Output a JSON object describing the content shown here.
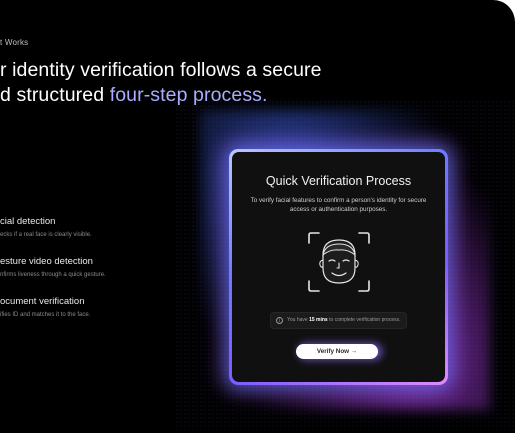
{
  "eyebrow": "t Works",
  "headline": {
    "line1": "r identity verification follows a secure",
    "line2_plain": "d structured ",
    "line2_highlight": "four-step process."
  },
  "steps": [
    {
      "title": "cial detection",
      "desc": "ecks if a real face is clearly visible."
    },
    {
      "title": "esture video detection",
      "desc": "nfirms liveness through a quick gesture."
    },
    {
      "title": "ocument verification",
      "desc": "ifies ID and matches it to the face."
    }
  ],
  "card": {
    "title": "Quick Verification Process",
    "subtitle": "To verify facial features to confirm a person's identity for secure access or authentication purposes.",
    "notice_before": "You have ",
    "notice_bold": "15 mins",
    "notice_after": " to complete verification process.",
    "notice_icon": "info-icon",
    "face_icon": "face-scan-icon",
    "button_label": "Verify Now",
    "button_icon": "arrow-right-icon",
    "button_arrow": "→"
  },
  "colors": {
    "highlight": "#a9adff",
    "glow_blue": "#6d7bff",
    "glow_purple": "#e08bff"
  }
}
